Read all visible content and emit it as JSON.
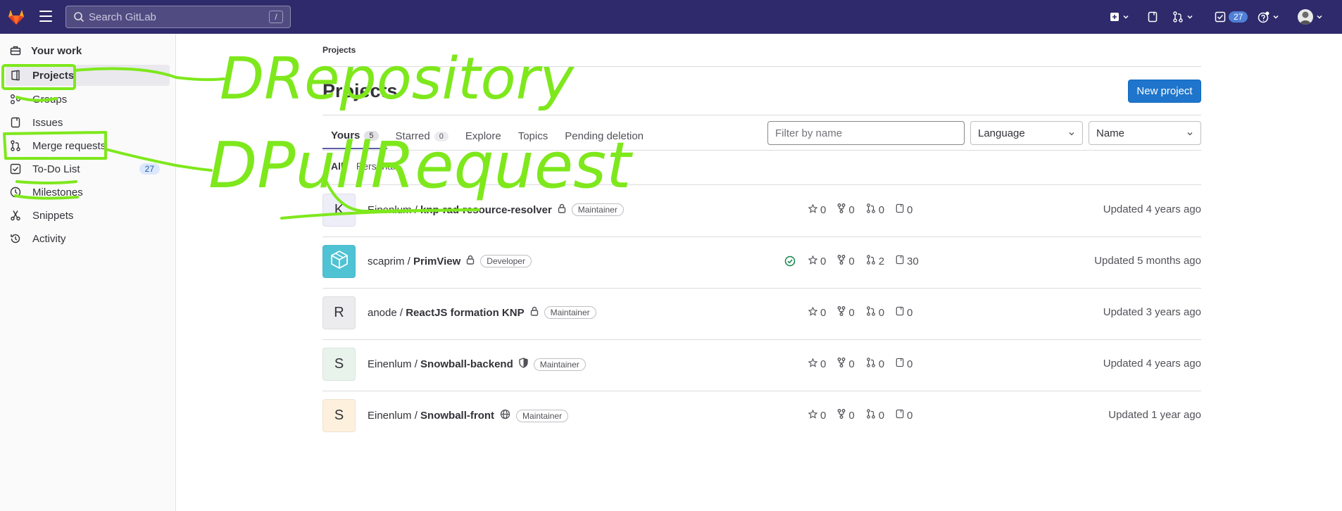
{
  "topbar": {
    "search_placeholder": "Search GitLab",
    "search_shortcut": "/",
    "todo_count": "27",
    "brand_color": "#2f2a6b"
  },
  "sidebar": {
    "header": "Your work",
    "items": [
      {
        "label": "Projects",
        "icon": "project-icon",
        "active": true
      },
      {
        "label": "Groups",
        "icon": "group-icon"
      },
      {
        "label": "Issues",
        "icon": "issues-icon"
      },
      {
        "label": "Merge requests",
        "icon": "merge-request-icon"
      },
      {
        "label": "To-Do List",
        "icon": "todo-icon",
        "count": "27"
      },
      {
        "label": "Milestones",
        "icon": "clock-icon"
      },
      {
        "label": "Snippets",
        "icon": "snippet-icon"
      },
      {
        "label": "Activity",
        "icon": "history-icon"
      }
    ]
  },
  "main": {
    "breadcrumb": "Projects",
    "title": "Projects",
    "new_project_label": "New project",
    "tabs": [
      {
        "label": "Yours",
        "count": "5",
        "active": true
      },
      {
        "label": "Starred",
        "count": "0"
      },
      {
        "label": "Explore"
      },
      {
        "label": "Topics"
      },
      {
        "label": "Pending deletion"
      }
    ],
    "filter_placeholder": "Filter by name",
    "language_label": "Language",
    "sort_label": "Name",
    "subtabs": [
      "All",
      "Personal"
    ],
    "projects": [
      {
        "avatar": "K",
        "avatar_color": "#eeeef8",
        "namespace": "Einenlum / ",
        "name": "knp-rad-resource-resolver",
        "visibility": "lock-icon",
        "role": "Maintainer",
        "stars": "0",
        "forks": "0",
        "mrs": "0",
        "issues": "0",
        "updated": "Updated 4 years ago"
      },
      {
        "avatar": "",
        "avatar_color": "#4fc3d4",
        "namespace": "scaprim / ",
        "name": "PrimView",
        "visibility": "lock-icon",
        "role": "Developer",
        "ci": "passed",
        "stars": "0",
        "forks": "0",
        "mrs": "2",
        "issues": "30",
        "updated": "Updated 5 months ago"
      },
      {
        "avatar": "R",
        "avatar_color": "#ececef",
        "namespace": "anode / ",
        "name": "ReactJS formation KNP",
        "visibility": "lock-icon",
        "role": "Maintainer",
        "stars": "0",
        "forks": "0",
        "mrs": "0",
        "issues": "0",
        "updated": "Updated 3 years ago"
      },
      {
        "avatar": "S",
        "avatar_color": "#e8f3ec",
        "namespace": "Einenlum / ",
        "name": "Snowball-backend",
        "visibility": "shield-icon",
        "role": "Maintainer",
        "stars": "0",
        "forks": "0",
        "mrs": "0",
        "issues": "0",
        "updated": "Updated 4 years ago"
      },
      {
        "avatar": "S",
        "avatar_color": "#fdf1dd",
        "namespace": "Einenlum / ",
        "name": "Snowball-front",
        "visibility": "globe-icon",
        "role": "Maintainer",
        "stars": "0",
        "forks": "0",
        "mrs": "0",
        "issues": "0",
        "updated": "Updated 1 year ago"
      }
    ]
  },
  "annotations": {
    "color": "#7ee81c",
    "text_1": "DRepository",
    "text_2": "DPullRequest"
  }
}
